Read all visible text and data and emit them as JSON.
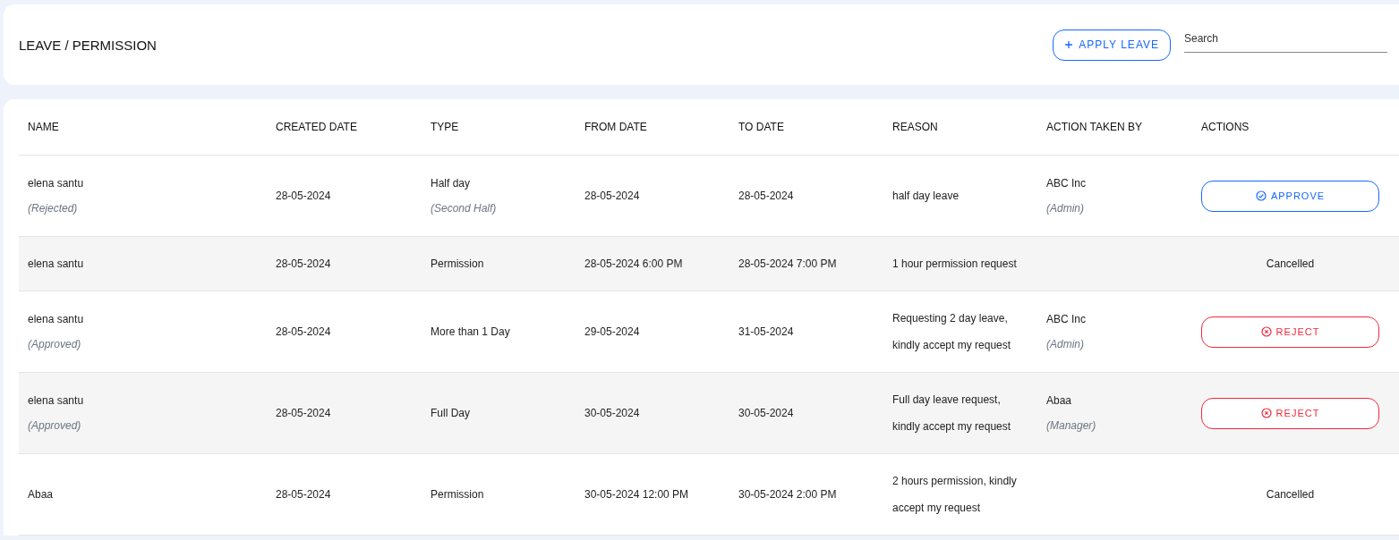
{
  "header": {
    "title": "LEAVE / PERMISSION",
    "apply_button": "APPLY LEAVE",
    "search": {
      "placeholder": "Search"
    }
  },
  "table": {
    "columns": [
      "NAME",
      "CREATED DATE",
      "TYPE",
      "FROM DATE",
      "TO DATE",
      "REASON",
      "ACTION TAKEN BY",
      "ACTIONS"
    ],
    "rows": [
      {
        "name": "elena santu",
        "status": "(Rejected)",
        "created": "28-05-2024",
        "type": "Half day",
        "type_note": "(Second Half)",
        "from": "28-05-2024",
        "to": "28-05-2024",
        "reason": "half day leave",
        "action_by": "ABC Inc",
        "action_by_role": "(Admin)",
        "action": {
          "kind": "approve",
          "label": "APPROVE"
        }
      },
      {
        "name": "elena santu",
        "created": "28-05-2024",
        "type": "Permission",
        "from": "28-05-2024 6:00 PM",
        "to": "28-05-2024 7:00 PM",
        "reason": "1 hour permission request",
        "action": {
          "kind": "status",
          "label": "Cancelled"
        }
      },
      {
        "name": "elena santu",
        "status": "(Approved)",
        "created": "28-05-2024",
        "type": "More than 1 Day",
        "from": "29-05-2024",
        "to": "31-05-2024",
        "reason": "Requesting 2 day leave, kindly accept my request",
        "action_by": "ABC Inc",
        "action_by_role": "(Admin)",
        "action": {
          "kind": "reject",
          "label": "REJECT"
        }
      },
      {
        "name": "elena santu",
        "status": "(Approved)",
        "created": "28-05-2024",
        "type": "Full Day",
        "from": "30-05-2024",
        "to": "30-05-2024",
        "reason": "Full day leave request, kindly accept my request",
        "action_by": "Abaa",
        "action_by_role": "(Manager)",
        "action": {
          "kind": "reject",
          "label": "REJECT"
        }
      },
      {
        "name": "Abaa",
        "created": "28-05-2024",
        "type": "Permission",
        "from": "30-05-2024 12:00 PM",
        "to": "30-05-2024 2:00 PM",
        "reason": "2 hours permission, kindly accept my request",
        "action": {
          "kind": "status",
          "label": "Cancelled"
        }
      }
    ]
  }
}
